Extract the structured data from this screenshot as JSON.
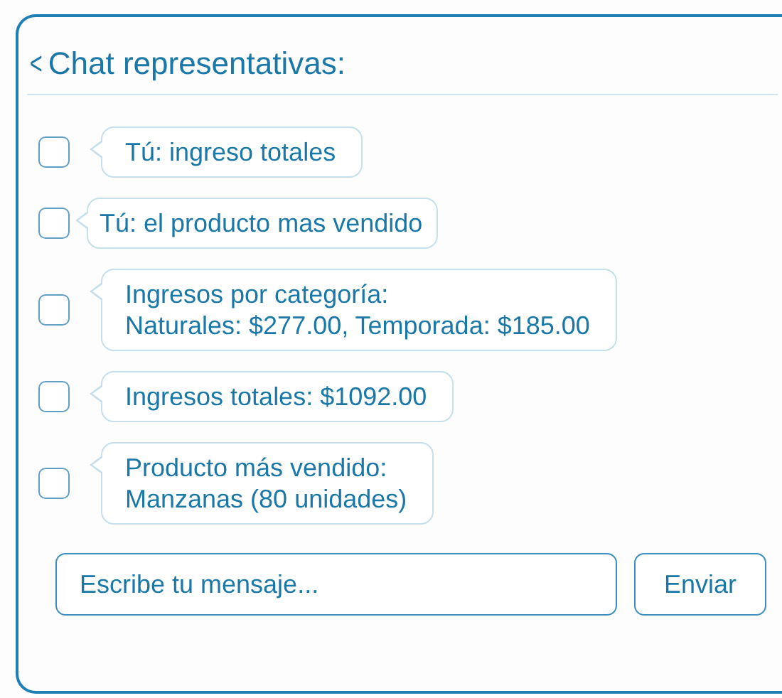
{
  "header": {
    "back": "<",
    "title": "Chat representativas:"
  },
  "messages": [
    {
      "checked": false,
      "lines": [
        "Tú: ingreso totales"
      ]
    },
    {
      "checked": false,
      "lines": [
        "Tú: el producto mas vendido"
      ]
    },
    {
      "checked": false,
      "lines": [
        "Ingresos por categoría:",
        "Naturales: $277.00, Temporada: $185.00"
      ]
    },
    {
      "checked": false,
      "lines": [
        "Ingresos totales: $1092.00"
      ]
    },
    {
      "checked": false,
      "lines": [
        "Producto más vendido:",
        "Manzanas (80 unidades)"
      ]
    }
  ],
  "composer": {
    "placeholder": "Escribe tu mensaje...",
    "send": "Enviar"
  }
}
